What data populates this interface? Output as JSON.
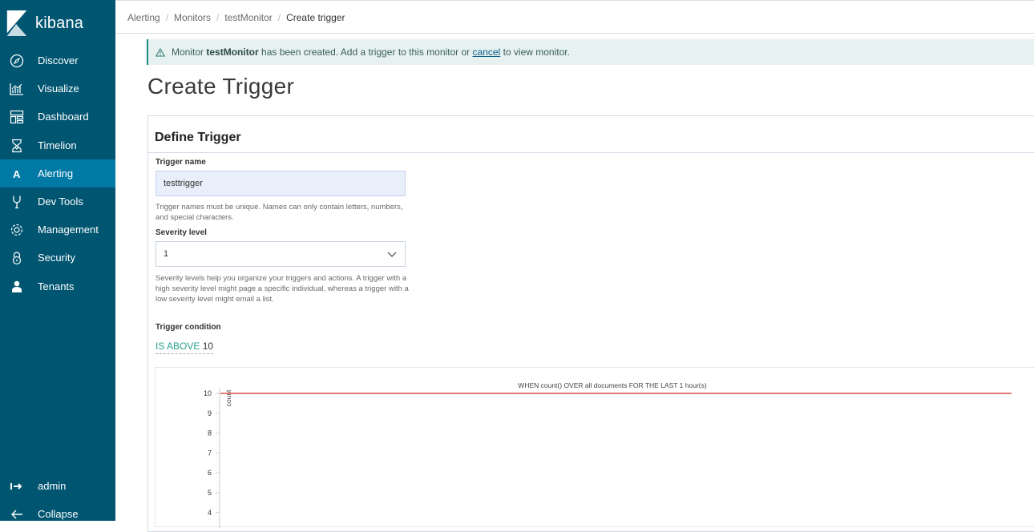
{
  "app": {
    "name": "kibana",
    "brand_color": "#005571",
    "active_color": "#0079a5",
    "accent": "#2a9d8f"
  },
  "sidebar": {
    "items": [
      {
        "label": "Discover",
        "icon": "compass-icon"
      },
      {
        "label": "Visualize",
        "icon": "chart-icon"
      },
      {
        "label": "Dashboard",
        "icon": "dashboard-icon"
      },
      {
        "label": "Timelion",
        "icon": "timelion-icon"
      },
      {
        "label": "Alerting",
        "icon": "alerting-icon",
        "active": true
      },
      {
        "label": "Dev Tools",
        "icon": "wrench-icon"
      },
      {
        "label": "Management",
        "icon": "gear-icon"
      },
      {
        "label": "Security",
        "icon": "lock-icon"
      },
      {
        "label": "Tenants",
        "icon": "user-icon"
      }
    ],
    "user": "admin",
    "collapse": "Collapse"
  },
  "breadcrumb": [
    "Alerting",
    "Monitors",
    "testMonitor",
    "Create trigger"
  ],
  "callout": {
    "prefix": "Monitor",
    "monitor": "testMonitor",
    "middle": "has been created. Add a trigger to this monitor or",
    "link": "cancel",
    "suffix": "to view monitor."
  },
  "page_title": "Create Trigger",
  "panel": {
    "title": "Define Trigger",
    "trigger_name": {
      "label": "Trigger name",
      "value": "testtrigger",
      "help": "Trigger names must be unique. Names can only contain letters, numbers, and special characters."
    },
    "severity": {
      "label": "Severity level",
      "value": "1",
      "help": "Severity levels help you organize your triggers and actions. A trigger with a high severity level might page a specific individual, whereas a trigger with a low severity level might email a list."
    },
    "condition": {
      "label": "Trigger condition",
      "keyword": "IS ABOVE",
      "value": "10"
    }
  },
  "chart_data": {
    "type": "line",
    "title": "WHEN count() OVER all documents FOR THE LAST 1 hour(s)",
    "ylabel": "count",
    "y_ticks": [
      10,
      9,
      8,
      7,
      6,
      5,
      4
    ],
    "threshold": 10,
    "threshold_color": "#e07b73",
    "series": []
  }
}
